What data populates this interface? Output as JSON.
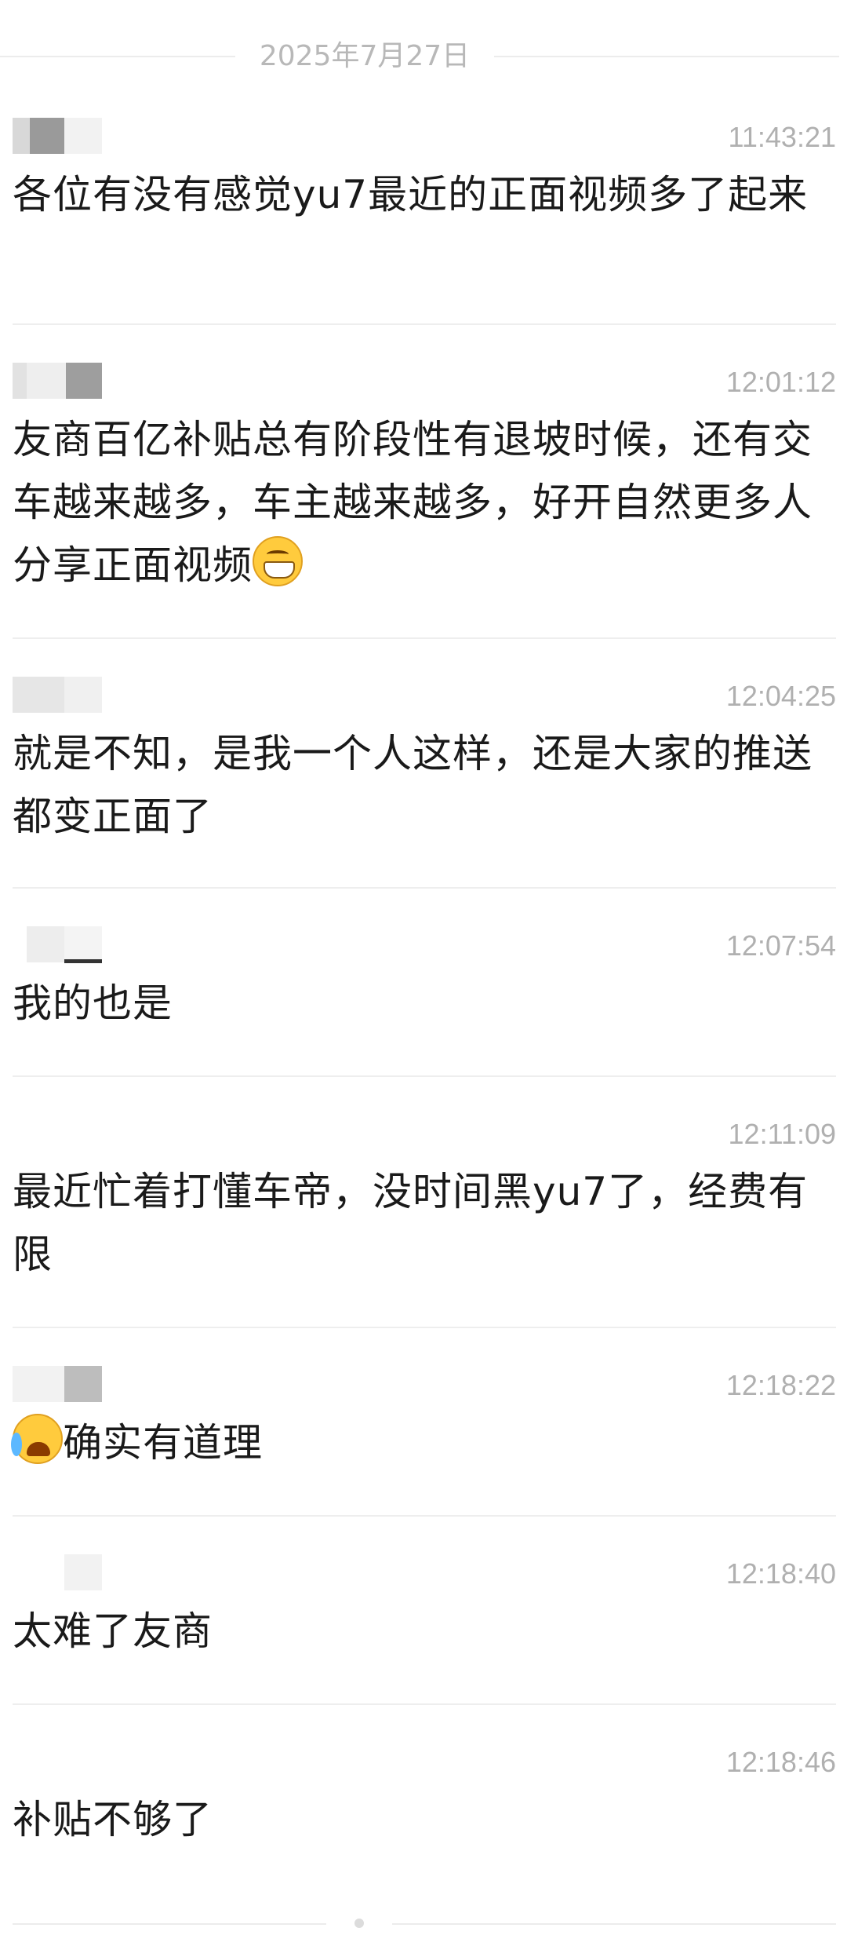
{
  "date_separator": "2025年7月27日",
  "messages": [
    {
      "time": "11:43:21",
      "text": "各位有没有感觉yu7最近的正面视频多了起来"
    },
    {
      "time": "12:01:12",
      "text": "友商百亿补贴总有阶段性有退坡时候，还有交车越来越多，车主越来越多，好开自然更多人分享正面视频",
      "emoji": "grin-icon"
    },
    {
      "time": "12:04:25",
      "text": "就是不知，是我一个人这样，还是大家的推送都变正面了"
    },
    {
      "time": "12:07:54",
      "text": "我的也是"
    },
    {
      "time": "12:11:09",
      "text": "最近忙着打懂车帝，没时间黑yu7了，经费有限"
    },
    {
      "time": "12:18:22",
      "text": "确实有道理",
      "emoji": "crying-laughing-icon"
    },
    {
      "time": "12:18:40",
      "text": "太难了友商"
    },
    {
      "time": "12:18:46",
      "text": "补贴不够了"
    }
  ],
  "colors": {
    "text": "#1a1a1a",
    "time": "#b0b0b0",
    "divider": "#eeeeee"
  }
}
